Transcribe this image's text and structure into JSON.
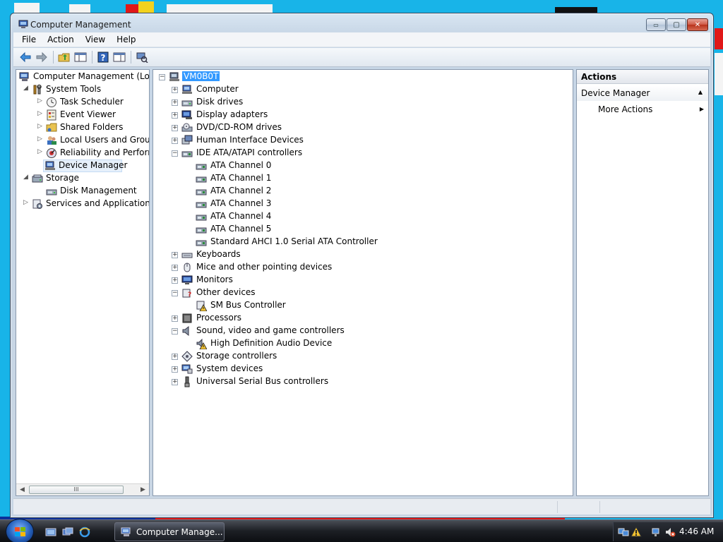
{
  "window": {
    "title": "Computer Management",
    "controls": {
      "minimize": "▭",
      "maximize": "▢",
      "close": "✕"
    }
  },
  "menu": [
    "File",
    "Action",
    "View",
    "Help"
  ],
  "toolbar_icons": [
    "back-arrow-icon",
    "forward-arrow-icon",
    "up-folder-icon",
    "show-hide-tree-icon",
    "help-icon",
    "show-hide-action-pane-icon",
    "scan-hardware-icon"
  ],
  "left_tree": {
    "items": [
      {
        "label": "Computer Management (Local",
        "level": 0,
        "expander": "none",
        "icon": "computer-management-icon"
      },
      {
        "label": "System Tools",
        "level": 1,
        "expander": "open",
        "icon": "system-tools-icon"
      },
      {
        "label": "Task Scheduler",
        "level": 2,
        "expander": "closed",
        "icon": "task-scheduler-icon"
      },
      {
        "label": "Event Viewer",
        "level": 2,
        "expander": "closed",
        "icon": "event-viewer-icon"
      },
      {
        "label": "Shared Folders",
        "level": 2,
        "expander": "closed",
        "icon": "shared-folders-icon"
      },
      {
        "label": "Local Users and Groups",
        "level": 2,
        "expander": "closed",
        "icon": "local-users-icon"
      },
      {
        "label": "Reliability and Performa",
        "level": 2,
        "expander": "closed",
        "icon": "reliability-icon"
      },
      {
        "label": "Device Manager",
        "level": 2,
        "expander": "none",
        "icon": "device-manager-icon",
        "selected": true
      },
      {
        "label": "Storage",
        "level": 1,
        "expander": "open",
        "icon": "storage-icon"
      },
      {
        "label": "Disk Management",
        "level": 2,
        "expander": "none",
        "icon": "disk-management-icon"
      },
      {
        "label": "Services and Applications",
        "level": 1,
        "expander": "closed",
        "icon": "services-icon"
      }
    ],
    "scroll_thumb": "III"
  },
  "device_tree": {
    "root": "VM0B0T",
    "items": [
      {
        "label": "Computer",
        "level": 1,
        "expander": "+",
        "icon": "computer-icon"
      },
      {
        "label": "Disk drives",
        "level": 1,
        "expander": "+",
        "icon": "disk-drive-icon"
      },
      {
        "label": "Display adapters",
        "level": 1,
        "expander": "+",
        "icon": "display-adapter-icon"
      },
      {
        "label": "DVD/CD-ROM drives",
        "level": 1,
        "expander": "+",
        "icon": "dvd-drive-icon"
      },
      {
        "label": "Human Interface Devices",
        "level": 1,
        "expander": "+",
        "icon": "hid-icon"
      },
      {
        "label": "IDE ATA/ATAPI controllers",
        "level": 1,
        "expander": "-",
        "icon": "ide-controller-icon"
      },
      {
        "label": "ATA Channel 0",
        "level": 2,
        "expander": "",
        "icon": "ide-controller-icon"
      },
      {
        "label": "ATA Channel 1",
        "level": 2,
        "expander": "",
        "icon": "ide-controller-icon"
      },
      {
        "label": "ATA Channel 2",
        "level": 2,
        "expander": "",
        "icon": "ide-controller-icon"
      },
      {
        "label": "ATA Channel 3",
        "level": 2,
        "expander": "",
        "icon": "ide-controller-icon"
      },
      {
        "label": "ATA Channel 4",
        "level": 2,
        "expander": "",
        "icon": "ide-controller-icon"
      },
      {
        "label": "ATA Channel 5",
        "level": 2,
        "expander": "",
        "icon": "ide-controller-icon"
      },
      {
        "label": "Standard AHCI 1.0 Serial ATA Controller",
        "level": 2,
        "expander": "",
        "icon": "ide-controller-icon"
      },
      {
        "label": "Keyboards",
        "level": 1,
        "expander": "+",
        "icon": "keyboard-icon"
      },
      {
        "label": "Mice and other pointing devices",
        "level": 1,
        "expander": "+",
        "icon": "mouse-icon"
      },
      {
        "label": "Monitors",
        "level": 1,
        "expander": "+",
        "icon": "monitor-icon"
      },
      {
        "label": "Other devices",
        "level": 1,
        "expander": "-",
        "icon": "unknown-device-icon"
      },
      {
        "label": "SM Bus Controller",
        "level": 2,
        "expander": "",
        "icon": "warning-device-icon"
      },
      {
        "label": "Processors",
        "level": 1,
        "expander": "+",
        "icon": "processor-icon"
      },
      {
        "label": "Sound, video and game controllers",
        "level": 1,
        "expander": "-",
        "icon": "speaker-icon"
      },
      {
        "label": "High Definition Audio Device",
        "level": 2,
        "expander": "",
        "icon": "warning-audio-icon"
      },
      {
        "label": "Storage controllers",
        "level": 1,
        "expander": "+",
        "icon": "storage-controller-icon"
      },
      {
        "label": "System devices",
        "level": 1,
        "expander": "+",
        "icon": "system-device-icon"
      },
      {
        "label": "Universal Serial Bus controllers",
        "level": 1,
        "expander": "+",
        "icon": "usb-icon"
      }
    ]
  },
  "actions": {
    "header": "Actions",
    "group": "Device Manager",
    "group_arrow": "▲",
    "item": "More Actions",
    "item_arrow": "▶"
  },
  "taskbar": {
    "task_label": "Computer Manage...",
    "clock": "4:46 AM"
  },
  "colors": {
    "selection": "#3399ff",
    "desktop": "#18b4e8"
  }
}
